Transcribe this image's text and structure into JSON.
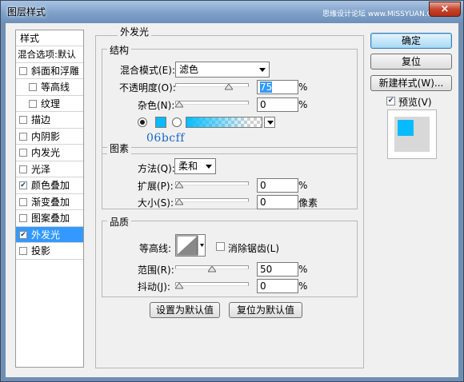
{
  "window": {
    "title": "图层样式",
    "watermark": "思缘设计论坛 www.MISSYUAN.COM",
    "close_glyph": "×"
  },
  "style_list": {
    "header": "样式",
    "blend_options": "混合选项:默认",
    "items": [
      {
        "label": "斜面和浮雕",
        "checked": false,
        "indent": false
      },
      {
        "label": "等高线",
        "checked": false,
        "indent": true
      },
      {
        "label": "纹理",
        "checked": false,
        "indent": true
      },
      {
        "label": "描边",
        "checked": false,
        "indent": false
      },
      {
        "label": "内阴影",
        "checked": false,
        "indent": false
      },
      {
        "label": "内发光",
        "checked": false,
        "indent": false
      },
      {
        "label": "光泽",
        "checked": false,
        "indent": false
      },
      {
        "label": "颜色叠加",
        "checked": true,
        "indent": false
      },
      {
        "label": "渐变叠加",
        "checked": false,
        "indent": false
      },
      {
        "label": "图案叠加",
        "checked": false,
        "indent": false
      },
      {
        "label": "外发光",
        "checked": true,
        "indent": false,
        "selected": true
      },
      {
        "label": "投影",
        "checked": false,
        "indent": false
      }
    ]
  },
  "panel": {
    "title": "外发光",
    "structure": {
      "label": "结构",
      "blend_mode_label": "混合模式(E):",
      "blend_mode_value": "滤色",
      "opacity_label": "不透明度(O):",
      "opacity_value": "75",
      "noise_label": "杂色(N):",
      "noise_value": "0",
      "percent": "%"
    },
    "annotation": "06bcff",
    "elements": {
      "label": "图素",
      "technique_label": "方法(Q):",
      "technique_value": "柔和",
      "spread_label": "扩展(P):",
      "spread_value": "0",
      "size_label": "大小(S):",
      "size_value": "0",
      "percent": "%",
      "pixels": "像素"
    },
    "quality": {
      "label": "品质",
      "contour_label": "等高线:",
      "antialias_label": "消除锯齿(L)",
      "antialias_checked": false,
      "range_label": "范围(R):",
      "range_value": "50",
      "jitter_label": "抖动(J):",
      "jitter_value": "0",
      "percent": "%"
    },
    "set_default": "设置为默认值",
    "reset_default": "复位为默认值"
  },
  "buttons": {
    "ok": "确定",
    "reset": "复位",
    "new_style": "新建样式(W)...",
    "preview_label": "预览(V)",
    "preview_checked": true
  },
  "colors": {
    "glow": "#06bcff",
    "selection": "#3399ff",
    "annotation": "#1566c6"
  }
}
